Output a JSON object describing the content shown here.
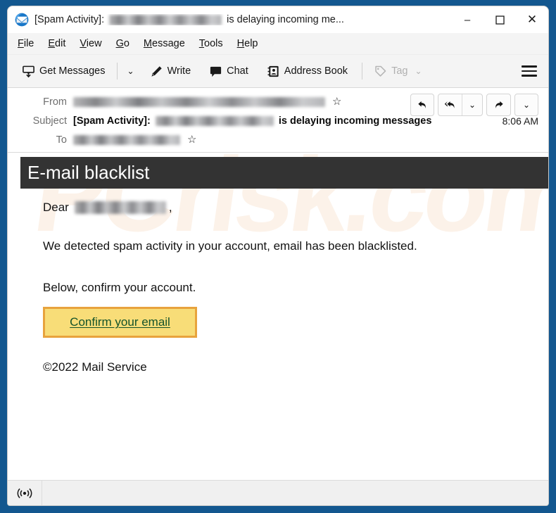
{
  "window": {
    "title_prefix": "[Spam Activity]:",
    "title_suffix": "is delaying incoming me...",
    "app_icon": "thunderbird-icon",
    "controls": {
      "minimize": "–",
      "maximize": "☐",
      "close": "✕"
    },
    "border_color": "#13578f"
  },
  "menu": {
    "items": [
      {
        "pre": "",
        "key": "F",
        "post": "ile"
      },
      {
        "pre": "",
        "key": "E",
        "post": "dit"
      },
      {
        "pre": "",
        "key": "V",
        "post": "iew"
      },
      {
        "pre": "",
        "key": "G",
        "post": "o"
      },
      {
        "pre": "",
        "key": "M",
        "post": "essage"
      },
      {
        "pre": "",
        "key": "T",
        "post": "ools"
      },
      {
        "pre": "",
        "key": "H",
        "post": "elp"
      }
    ]
  },
  "toolbar": {
    "get_messages": "Get Messages",
    "get_messages_icon": "inbox-download-icon",
    "get_messages_chevron": "⌄",
    "write": "Write",
    "write_icon": "pencil-icon",
    "chat": "Chat",
    "chat_icon": "speech-bubble-icon",
    "address_book": "Address Book",
    "address_book_icon": "contact-card-icon",
    "tag": "Tag",
    "tag_icon": "tag-icon",
    "tag_chevron": "⌄",
    "tag_disabled": true,
    "app_menu_icon": "hamburger-menu-icon"
  },
  "message_header": {
    "from_label": "From",
    "from_value_redacted": true,
    "subject_label": "Subject",
    "subject_bold_prefix": "[Spam Activity]:",
    "subject_redacted": true,
    "subject_bold_suffix": "is delaying incoming messages",
    "time": "8:06 AM",
    "to_label": "To",
    "to_value_redacted": true,
    "star_icon": "star-outline-icon",
    "actions": {
      "reply": "↩",
      "reply_all": "↫",
      "reply_all_chevron": "⌄",
      "forward": "↪",
      "more_chevron": "⌄"
    }
  },
  "email": {
    "banner_title": "E-mail blacklist",
    "banner_bg": "#333333",
    "greeting_prefix": "Dear",
    "greeting_suffix": ",",
    "paragraph_1": "We detected spam activity in your account, email has been blacklisted.",
    "paragraph_2": "Below, confirm your account.",
    "cta_label": "Confirm your email",
    "cta_bg": "#f8dd78",
    "cta_border": "#e8a33d",
    "cta_text_color": "#14532a",
    "footer": "©2022 Mail Service",
    "watermark": "PCrisk.com"
  },
  "status_bar": {
    "online_icon": "broadcast-online-icon",
    "text": ""
  }
}
